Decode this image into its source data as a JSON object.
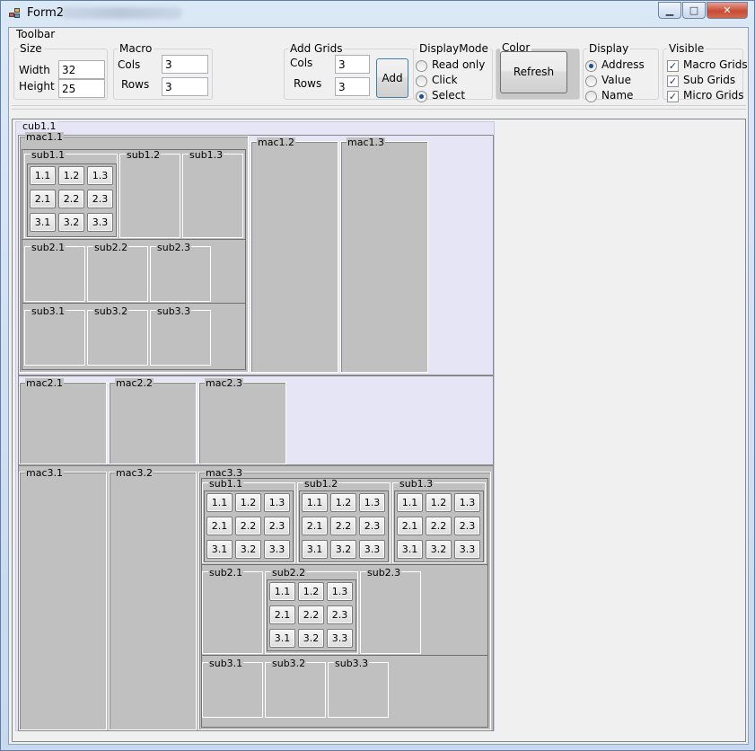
{
  "window": {
    "title": "Form2",
    "minimize_glyph": "▁",
    "maximize_glyph": "□",
    "close_glyph": "✕"
  },
  "toolbar": {
    "label": "Toolbar",
    "size": {
      "label": "Size",
      "width_label": "Width",
      "width_value": "32",
      "height_label": "Height",
      "height_value": "25"
    },
    "macro": {
      "label": "Macro",
      "cols_label": "Cols",
      "cols_value": "3",
      "rows_label": "Rows",
      "rows_value": "3"
    },
    "add_grids": {
      "label": "Add Grids",
      "cols_label": "Cols",
      "cols_value": "3",
      "rows_label": "Rows",
      "rows_value": "3",
      "add_button": "Add"
    },
    "display_mode": {
      "label": "DisplayMode",
      "options": [
        "Read only",
        "Click",
        "Select"
      ],
      "selected": "Select"
    },
    "color": {
      "label": "Color",
      "refresh_button": "Refresh"
    },
    "display": {
      "label": "Display",
      "options": [
        "Address",
        "Value",
        "Name"
      ],
      "selected": "Address"
    },
    "visible": {
      "label": "Visible",
      "options": [
        "Macro Grids",
        "Sub Grids",
        "Micro Grids"
      ],
      "check_glyph": "✓"
    }
  },
  "grid": {
    "cube_label": "cub1.1",
    "macros": [
      "mac1.1",
      "mac1.2",
      "mac1.3",
      "mac2.1",
      "mac2.2",
      "mac2.3",
      "mac3.1",
      "mac3.2",
      "mac3.3"
    ],
    "subs": [
      "sub1.1",
      "sub1.2",
      "sub1.3",
      "sub2.1",
      "sub2.2",
      "sub2.3",
      "sub3.1",
      "sub3.2",
      "sub3.3"
    ],
    "cells": [
      "1.1",
      "1.2",
      "1.3",
      "2.1",
      "2.2",
      "2.3",
      "3.1",
      "3.2",
      "3.3"
    ]
  },
  "colors": {
    "grid_fill": "#c0c0c0",
    "cube_fill": "#e5e5f5",
    "window_frame": "#dbe8f6"
  },
  "icons": {
    "app": "app-icon",
    "minimize": "minimize-icon",
    "maximize": "maximize-icon",
    "close": "close-icon"
  }
}
